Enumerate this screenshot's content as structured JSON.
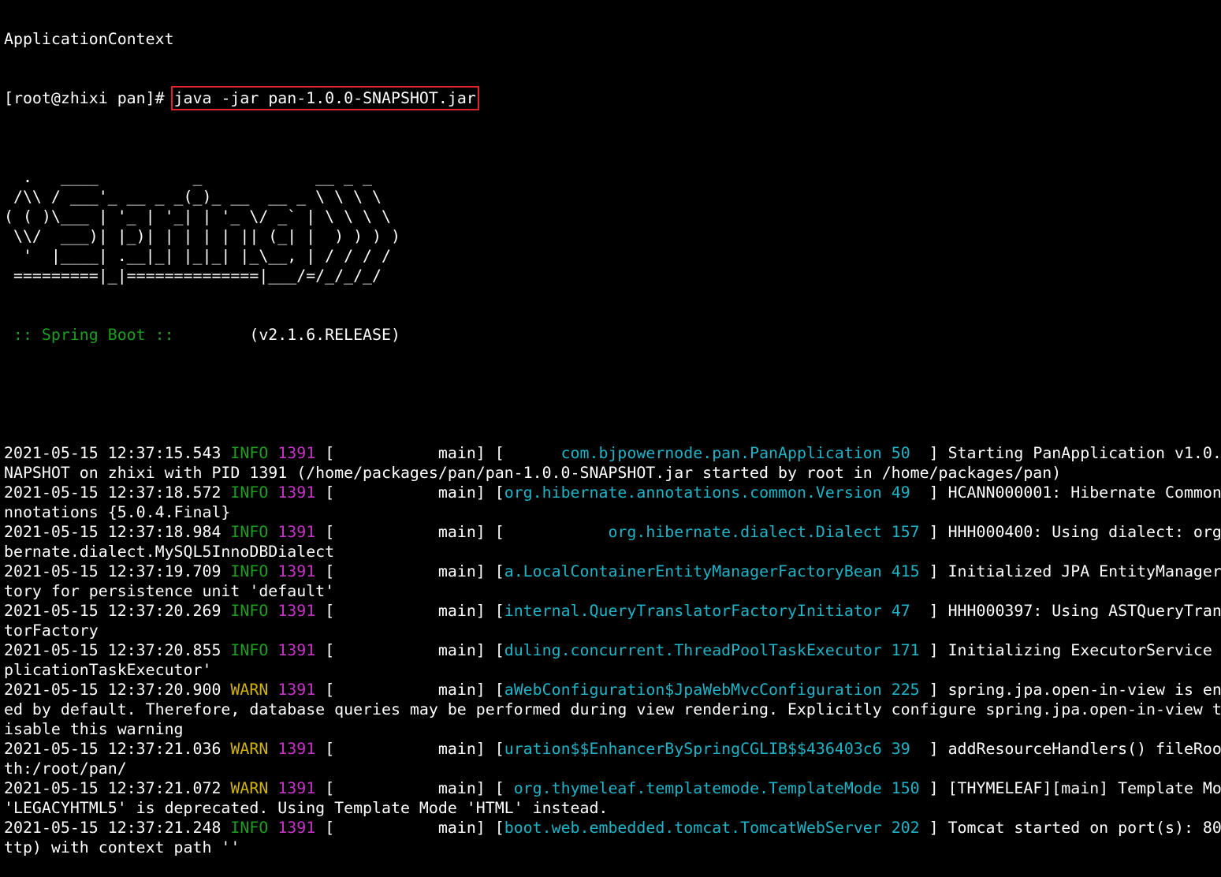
{
  "terminal": {
    "top_line": "ApplicationContext",
    "prompt": "[root@zhixi pan]# ",
    "command": "java -jar pan-1.0.0-SNAPSHOT.jar",
    "banner": [
      "",
      "  .   ____          _            __ _ _",
      " /\\\\ / ___'_ __ _ _(_)_ __  __ _ \\ \\ \\ \\",
      "( ( )\\___ | '_ | '_| | '_ \\/ _` | \\ \\ \\ \\",
      " \\\\/  ___)| |_)| | | | | || (_| |  ) ) ) )",
      "  '  |____| .__|_| |_|_| |_\\__, | / / / /",
      " =========|_|==============|___/=/_/_/_/"
    ],
    "spring_label": " :: Spring Boot :: ",
    "spring_version": "       (v2.1.6.RELEASE)",
    "log_lines": [
      {
        "ts": "2021-05-15 12:37:15.543",
        "level": "INFO",
        "pid": "1391",
        "thread": " [           main] [",
        "logger": "      com.bjpowernode.pan.PanApplication 50  ",
        "msg": "] Starting PanApplication v1.0.",
        "cont": [
          "NAPSHOT on zhixi with PID 1391 (/home/packages/pan/pan-1.0.0-SNAPSHOT.jar started by root in /home/packages/pan)"
        ]
      },
      {
        "ts": "2021-05-15 12:37:18.572",
        "level": "INFO",
        "pid": "1391",
        "thread": " [           main] [",
        "logger": "org.hibernate.annotations.common.Version 49  ",
        "msg": "] HCANN000001: Hibernate Common",
        "cont": [
          "nnotations {5.0.4.Final}"
        ]
      },
      {
        "ts": "2021-05-15 12:37:18.984",
        "level": "INFO",
        "pid": "1391",
        "thread": " [           main] [",
        "logger": "           org.hibernate.dialect.Dialect 157 ",
        "msg": "] HHH000400: Using dialect: org",
        "cont": [
          "bernate.dialect.MySQL5InnoDBDialect"
        ]
      },
      {
        "ts": "2021-05-15 12:37:19.709",
        "level": "INFO",
        "pid": "1391",
        "thread": " [           main] [",
        "logger": "a.LocalContainerEntityManagerFactoryBean 415 ",
        "msg": "] Initialized JPA EntityManager",
        "cont": [
          "tory for persistence unit 'default'"
        ]
      },
      {
        "ts": "2021-05-15 12:37:20.269",
        "level": "INFO",
        "pid": "1391",
        "thread": " [           main] [",
        "logger": "internal.QueryTranslatorFactoryInitiator 47  ",
        "msg": "] HHH000397: Using ASTQueryTran",
        "cont": [
          "torFactory"
        ]
      },
      {
        "ts": "2021-05-15 12:37:20.855",
        "level": "INFO",
        "pid": "1391",
        "thread": " [           main] [",
        "logger": "duling.concurrent.ThreadPoolTaskExecutor 171 ",
        "msg": "] Initializing ExecutorService",
        "cont": [
          "plicationTaskExecutor'"
        ]
      },
      {
        "ts": "2021-05-15 12:37:20.900",
        "level": "WARN",
        "pid": "1391",
        "thread": " [           main] [",
        "logger": "aWebConfiguration$JpaWebMvcConfiguration 225 ",
        "msg": "] spring.jpa.open-in-view is en",
        "cont": [
          "ed by default. Therefore, database queries may be performed during view rendering. Explicitly configure spring.jpa.open-in-view t",
          "isable this warning"
        ]
      },
      {
        "ts": "2021-05-15 12:37:21.036",
        "level": "WARN",
        "pid": "1391",
        "thread": " [           main] [",
        "logger": "uration$$EnhancerBySpringCGLIB$$436403c6 39  ",
        "msg": "] addResourceHandlers() fileRoo",
        "cont": [
          "th:/root/pan/"
        ]
      },
      {
        "ts": "2021-05-15 12:37:21.072",
        "level": "WARN",
        "pid": "1391",
        "thread": " [           main] [",
        "logger": " org.thymeleaf.templatemode.TemplateMode 150 ",
        "msg": "] [THYMELEAF][main] Template Mo",
        "cont": [
          "'LEGACYHTML5' is deprecated. Using Template Mode 'HTML' instead."
        ]
      },
      {
        "ts": "2021-05-15 12:37:21.248",
        "level": "INFO",
        "pid": "1391",
        "thread": " [           main] [",
        "logger": "boot.web.embedded.tomcat.TomcatWebServer 202 ",
        "msg": "] Tomcat started on port(s): 80",
        "cont": [
          "ttp) with context path ''"
        ]
      }
    ]
  },
  "colors": {
    "background": "#000000",
    "text": "#ffffff",
    "info": "#1e9e1e",
    "warn": "#d2b400",
    "pid": "#c832c8",
    "logger": "#1eb4c8",
    "highlight_box": "#e0242a"
  }
}
